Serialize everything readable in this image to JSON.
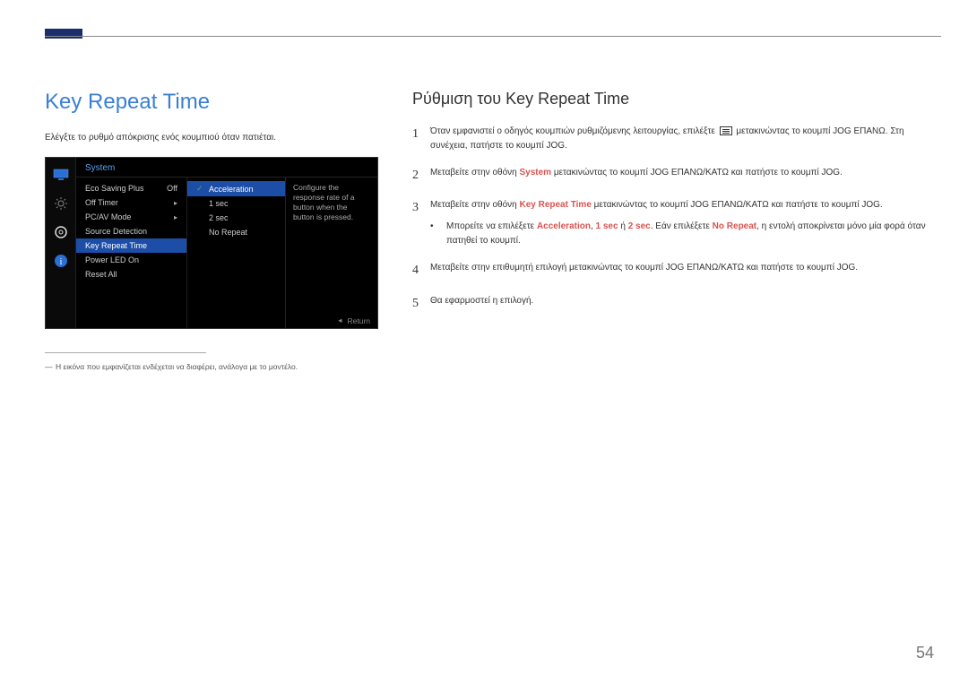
{
  "page": {
    "number": "54"
  },
  "left": {
    "title": "Key Repeat Time",
    "intro": "Ελέγξτε το ρυθμό απόκρισης ενός κουμπιού όταν πατιέται.",
    "footnote": "Η εικόνα που εμφανίζεται ενδέχεται να διαφέρει, ανάλογα με το μοντέλο."
  },
  "osd": {
    "header": "System",
    "desc": "Configure the response rate of a button when the button is pressed.",
    "footer_return": "Return",
    "items": [
      {
        "label": "Eco Saving Plus",
        "value": "Off"
      },
      {
        "label": "Off Timer",
        "value": "▸"
      },
      {
        "label": "PC/AV Mode",
        "value": "▸"
      },
      {
        "label": "Source Detection",
        "value": ""
      },
      {
        "label": "Key Repeat Time",
        "value": ""
      },
      {
        "label": "Power LED On",
        "value": ""
      },
      {
        "label": "Reset All",
        "value": ""
      }
    ],
    "submenu": [
      {
        "label": "Acceleration",
        "selected": true
      },
      {
        "label": "1 sec",
        "selected": false
      },
      {
        "label": "2 sec",
        "selected": false
      },
      {
        "label": "No Repeat",
        "selected": false
      }
    ]
  },
  "right": {
    "title": "Ρύθμιση του Key Repeat Time",
    "steps": {
      "1": {
        "pre": "Όταν εμφανιστεί ο οδηγός κουμπιών ρυθμιζόμενης λειτουργίας, επιλέξτε ",
        "post": " μετακινώντας το κουμπί JOG ΕΠΑΝΩ. Στη συνέχεια, πατήστε το κουμπί JOG."
      },
      "2": {
        "pre": "Μεταβείτε στην οθόνη ",
        "hl": "System",
        "post": " μετακινώντας το κουμπί JOG ΕΠΑΝΩ/ΚΑΤΩ και πατήστε το κουμπί JOG."
      },
      "3": {
        "pre": "Μεταβείτε στην οθόνη ",
        "hl": "Key Repeat Time",
        "post": " μετακινώντας το κουμπί JOG ΕΠΑΝΩ/ΚΑΤΩ και πατήστε το κουμπί JOG."
      },
      "bullet": {
        "pre": "Μπορείτε να επιλέξετε ",
        "a": "Acceleration",
        "sep1": ", ",
        "b": "1 sec",
        "sep2": " ή ",
        "c": "2 sec",
        "mid": ". Εάν επιλέξετε ",
        "d": "No Repeat",
        "post": ", η εντολή αποκρίνεται μόνο μία φορά όταν πατηθεί το κουμπί."
      },
      "4": "Μεταβείτε στην επιθυμητή επιλογή μετακινώντας το κουμπί JOG ΕΠΑΝΩ/ΚΑΤΩ και πατήστε το κουμπί JOG.",
      "5": "Θα εφαρμοστεί η επιλογή."
    }
  }
}
